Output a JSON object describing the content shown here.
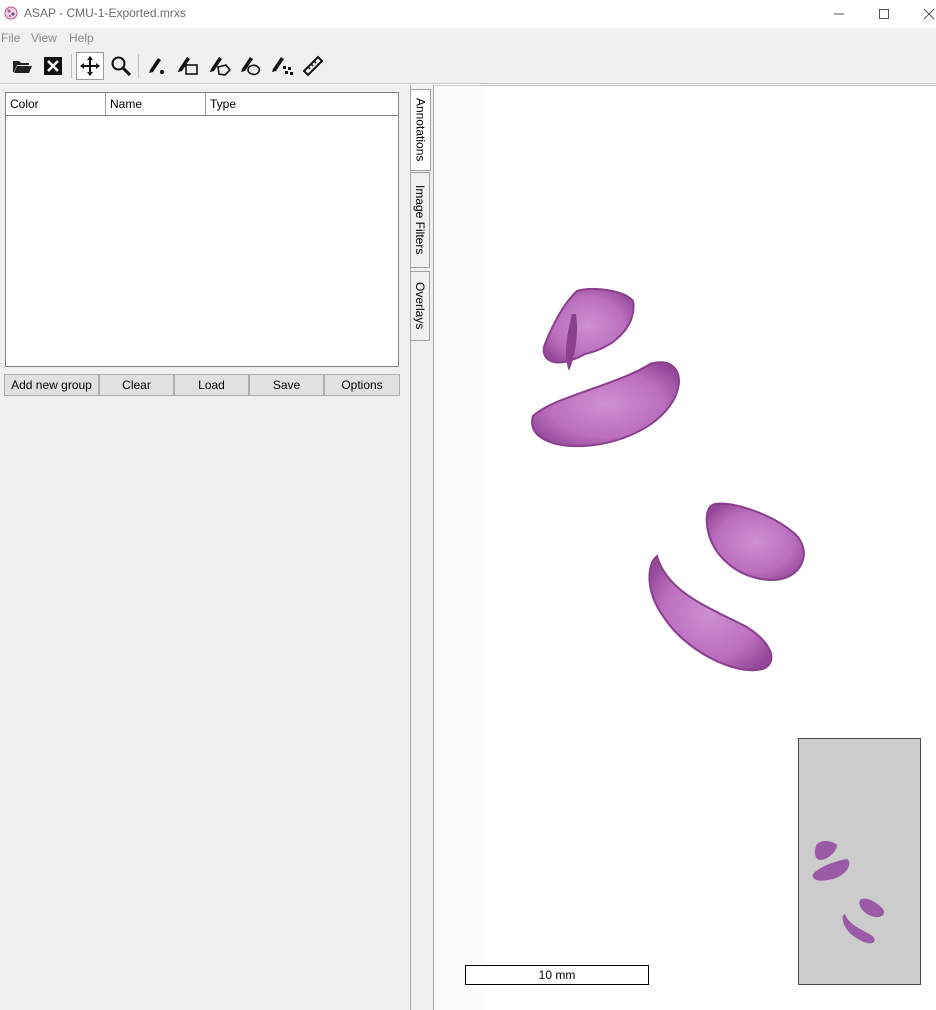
{
  "window": {
    "title": "ASAP - CMU-1-Exported.mrxs",
    "minimize_glyph": "—",
    "maximize_glyph": "☐",
    "close_glyph": "✕"
  },
  "menu": {
    "items": [
      {
        "label": "File"
      },
      {
        "label": "View"
      },
      {
        "label": "Help"
      }
    ]
  },
  "toolbar": {
    "tools": [
      {
        "icon": "open-folder-icon"
      },
      {
        "icon": "close-file-icon"
      },
      {
        "icon": "pan-icon",
        "active": true
      },
      {
        "icon": "zoom-icon"
      },
      {
        "icon": "dot-annotation-icon"
      },
      {
        "icon": "rectangle-annotation-icon"
      },
      {
        "icon": "polygon-annotation-icon"
      },
      {
        "icon": "spline-annotation-icon"
      },
      {
        "icon": "point-set-annotation-icon"
      },
      {
        "icon": "ruler-icon"
      }
    ]
  },
  "annotations_panel": {
    "columns": [
      {
        "label": "Color"
      },
      {
        "label": "Name"
      },
      {
        "label": "Type"
      }
    ],
    "buttons": {
      "add_group": "Add new group",
      "clear": "Clear",
      "load": "Load",
      "save": "Save",
      "options": "Options"
    }
  },
  "side_tabs": [
    {
      "label": "Annotations",
      "active": true
    },
    {
      "label": "Image Filters",
      "active": false
    },
    {
      "label": "Overlays",
      "active": false
    }
  ],
  "viewer": {
    "scale_label": "10 mm"
  },
  "colors": {
    "tissue": "#b86ab8",
    "tissue_dark": "#8a3f8f",
    "minimap_bg": "#cccccc"
  }
}
